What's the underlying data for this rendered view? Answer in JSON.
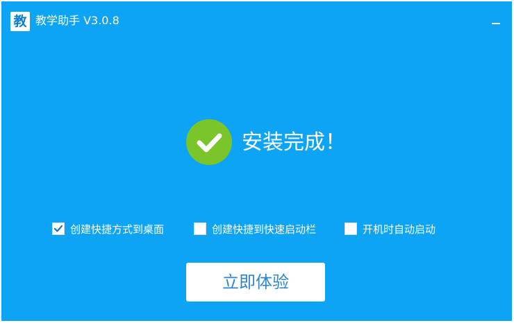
{
  "window": {
    "logo_char": "教",
    "title": "教学助手 V3.0.8",
    "background_color": "#0ea4f6"
  },
  "titlebar": {
    "minimize_icon": "minimize-icon"
  },
  "status": {
    "icon": "check-circle-icon",
    "icon_color": "#7ac52a",
    "message": "安装完成！"
  },
  "options": [
    {
      "label": "创建快捷方式到桌面",
      "checked": true
    },
    {
      "label": "创建快捷到快速启动栏",
      "checked": false
    },
    {
      "label": "开机时自动启动",
      "checked": false
    }
  ],
  "action": {
    "button_label": "立即体验",
    "button_text_color": "#2f86c8"
  }
}
